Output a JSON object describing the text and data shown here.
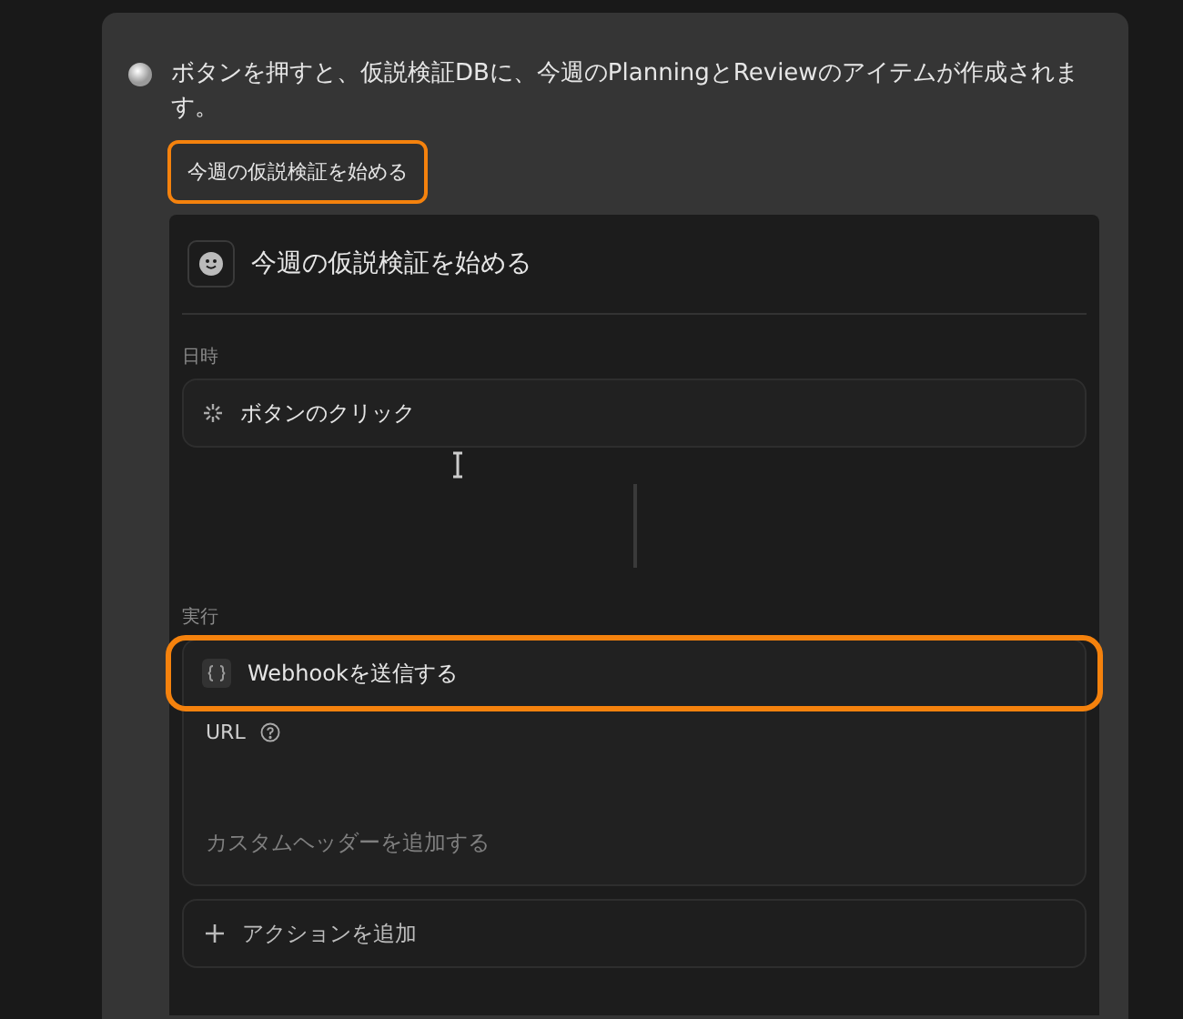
{
  "description": "ボタンを押すと、仮説検証DBに、今週のPlanningとReviewのアイテムが作成されます。",
  "button": {
    "label": "今週の仮説検証を始める",
    "highlighted": true
  },
  "automation": {
    "title": "今週の仮説検証を始める",
    "trigger": {
      "section_label": "日時",
      "label": "ボタンのクリック"
    },
    "action": {
      "section_label": "実行",
      "label": "Webhookを送信する",
      "highlighted": true,
      "field_label": "URL",
      "link": "カスタムヘッダーを追加する"
    },
    "add_action": {
      "label": "アクションを追加"
    }
  }
}
